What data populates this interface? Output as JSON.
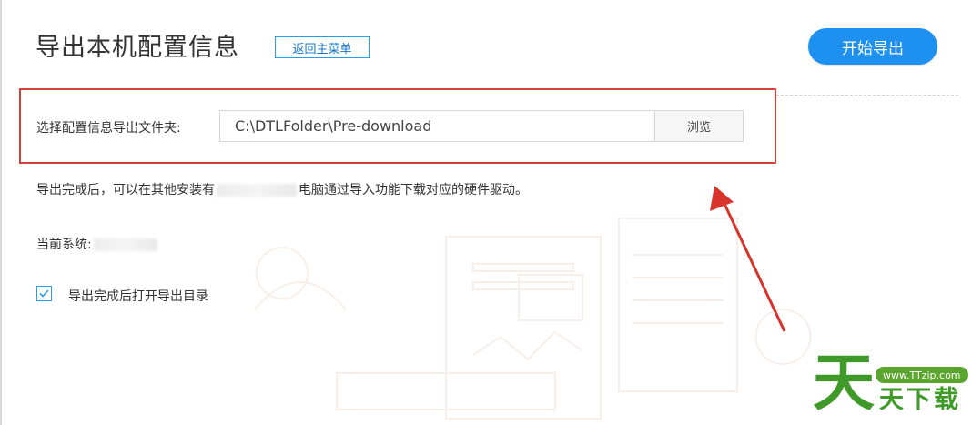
{
  "header": {
    "title": "导出本机配置信息",
    "back_label": "返回主菜单",
    "start_label": "开始导出"
  },
  "export_folder": {
    "label": "选择配置信息导出文件夹:",
    "path_value": "C:\\DTLFolder\\Pre-download",
    "browse_label": "浏览"
  },
  "info": {
    "before": "导出完成后，可以在其他安装有",
    "after": "电脑通过导入功能下载对应的硬件驱动。"
  },
  "current_system": {
    "label": "当前系统:"
  },
  "options": {
    "open_after_export_label": "导出完成后打开导出目录",
    "open_after_export_checked": true
  },
  "watermark": {
    "url": "www.TTzip.com",
    "big_char": "天",
    "text": "天下载"
  },
  "colors": {
    "accent": "#1e90f0",
    "highlight": "#d2413c",
    "arrow": "#d9342b",
    "watermark": "#3f9a2a"
  },
  "icons": [
    "checkmark-icon",
    "annotation-arrow"
  ]
}
